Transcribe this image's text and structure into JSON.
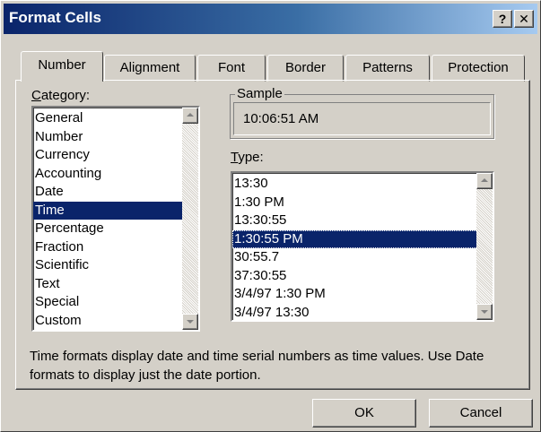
{
  "window": {
    "title": "Format Cells",
    "help_glyph": "?",
    "close_glyph": "✕"
  },
  "tabs": [
    {
      "label": "Number",
      "active": true
    },
    {
      "label": "Alignment",
      "active": false
    },
    {
      "label": "Font",
      "active": false
    },
    {
      "label": "Border",
      "active": false
    },
    {
      "label": "Patterns",
      "active": false
    },
    {
      "label": "Protection",
      "active": false
    }
  ],
  "category": {
    "label_rest": "ategory:",
    "label_mnemonic": "C",
    "items": [
      "General",
      "Number",
      "Currency",
      "Accounting",
      "Date",
      "Time",
      "Percentage",
      "Fraction",
      "Scientific",
      "Text",
      "Special",
      "Custom"
    ],
    "selected": "Time"
  },
  "sample": {
    "legend": "Sample",
    "value": "10:06:51 AM"
  },
  "type": {
    "label_mnemonic": "T",
    "label_rest": "ype:",
    "items": [
      "13:30",
      "1:30 PM",
      "13:30:55",
      "1:30:55 PM",
      "30:55.7",
      "37:30:55",
      "3/4/97 1:30 PM",
      "3/4/97 13:30"
    ],
    "selected": "1:30:55 PM"
  },
  "description": "Time formats display date and time serial numbers as time values.  Use Date formats to display just the date portion.",
  "buttons": {
    "ok": "OK",
    "cancel": "Cancel"
  },
  "colors": {
    "title_bar": "#0a246a",
    "selection": "#0a246a",
    "face": "#d4d0c8"
  }
}
